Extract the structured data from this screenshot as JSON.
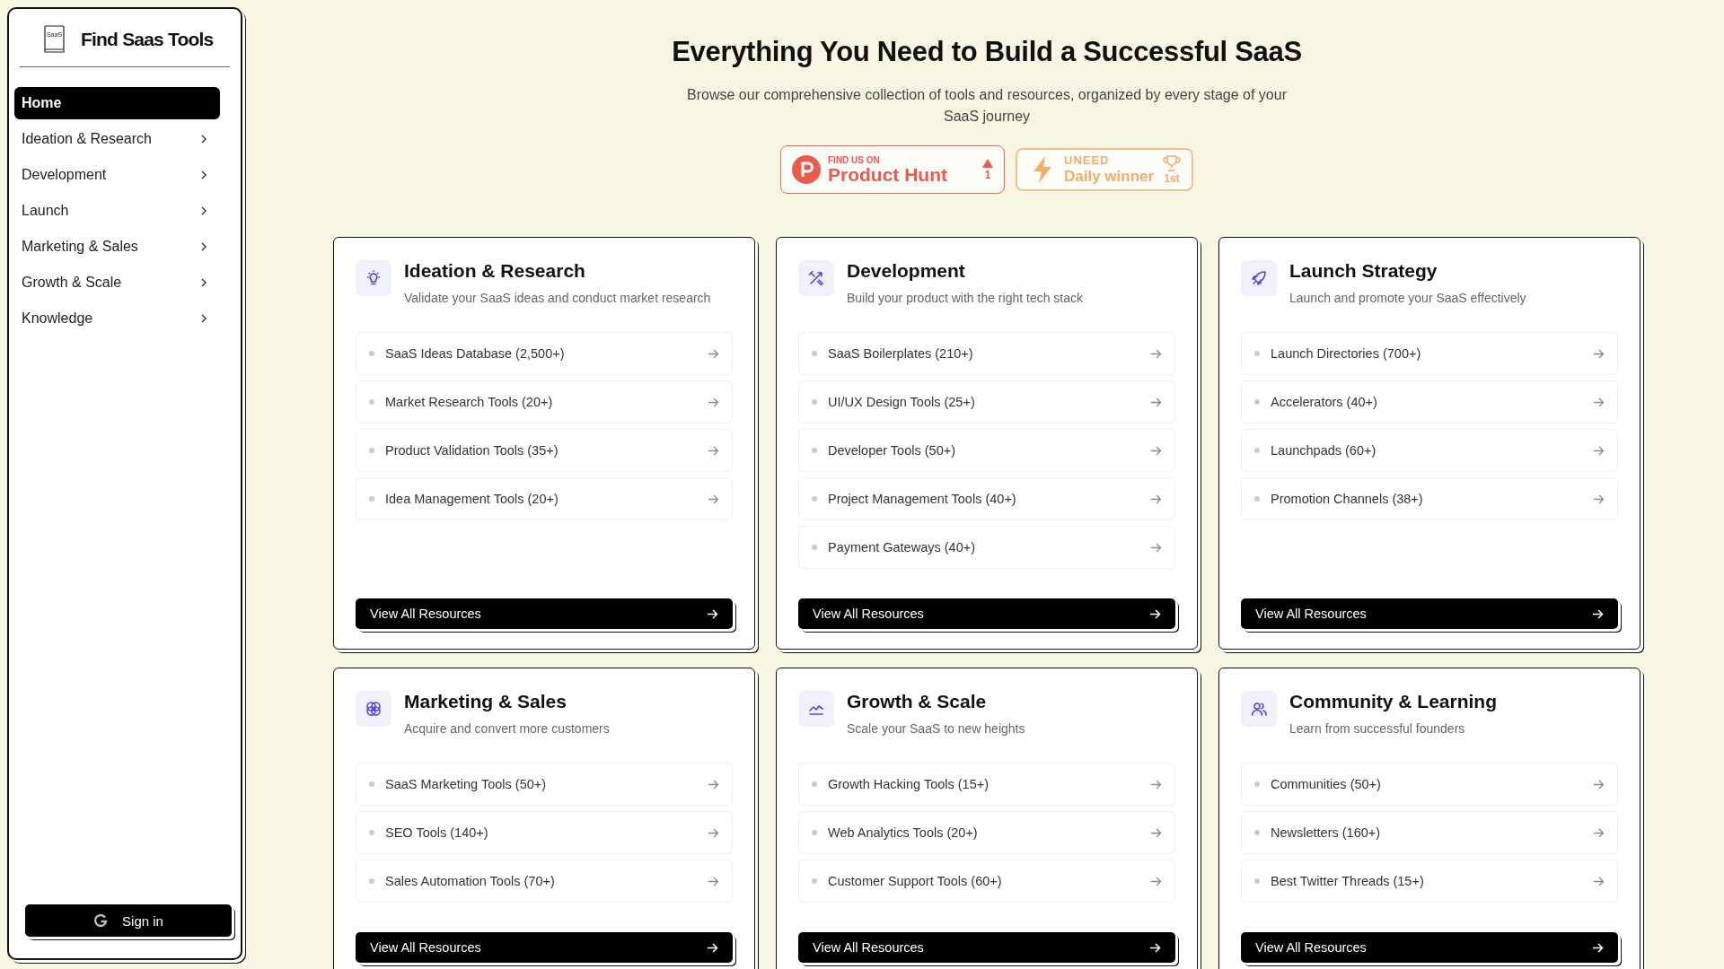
{
  "sidebar": {
    "logo_mark": "SaaS",
    "brand": "Find Saas Tools",
    "items": [
      {
        "label": "Home",
        "selected": true,
        "expandable": false
      },
      {
        "label": "Ideation & Research",
        "selected": false,
        "expandable": true
      },
      {
        "label": "Development",
        "selected": false,
        "expandable": true
      },
      {
        "label": "Launch",
        "selected": false,
        "expandable": true
      },
      {
        "label": "Marketing & Sales",
        "selected": false,
        "expandable": true
      },
      {
        "label": "Growth & Scale",
        "selected": false,
        "expandable": true
      },
      {
        "label": "Knowledge",
        "selected": false,
        "expandable": true
      }
    ],
    "sign_in": "Sign in"
  },
  "hero": {
    "title": "Everything You Need to Build a Successful SaaS",
    "subtitle": "Browse our comprehensive collection of tools and resources, organized by every stage of your SaaS journey",
    "badges": [
      {
        "kind": "producthunt",
        "eyebrow": "FIND US ON",
        "name": "Product Hunt",
        "count": "1"
      },
      {
        "kind": "uneed",
        "eyebrow": "UNEED",
        "name": "Daily winner",
        "count": "1st"
      }
    ]
  },
  "cards": [
    {
      "title": "Ideation & Research",
      "subtitle": "Validate your SaaS ideas and conduct market research",
      "links": [
        "SaaS Ideas Database (2,500+)",
        "Market Research Tools (20+)",
        "Product Validation Tools (35+)",
        "Idea Management Tools (20+)"
      ],
      "button": "View All Resources"
    },
    {
      "title": "Development",
      "subtitle": "Build your product with the right tech stack",
      "links": [
        "SaaS Boilerplates (210+)",
        "UI/UX Design Tools (25+)",
        "Developer Tools (50+)",
        "Project Management Tools (40+)",
        "Payment Gateways (40+)"
      ],
      "button": "View All Resources"
    },
    {
      "title": "Launch Strategy",
      "subtitle": "Launch and promote your SaaS effectively",
      "links": [
        "Launch Directories (700+)",
        "Accelerators (40+)",
        "Launchpads (60+)",
        "Promotion Channels (38+)"
      ],
      "button": "View All Resources"
    },
    {
      "title": "Marketing & Sales",
      "subtitle": "Acquire and convert more customers",
      "links": [
        "SaaS Marketing Tools (50+)",
        "SEO Tools (140+)",
        "Sales Automation Tools (70+)"
      ],
      "button": "View All Resources"
    },
    {
      "title": "Growth & Scale",
      "subtitle": "Scale your SaaS to new heights",
      "links": [
        "Growth Hacking Tools (15+)",
        "Web Analytics Tools (20+)",
        "Customer Support Tools (60+)"
      ],
      "button": "View All Resources"
    },
    {
      "title": "Community & Learning",
      "subtitle": "Learn from successful founders",
      "links": [
        "Communities (50+)",
        "Newsletters (160+)",
        "Best Twitter Threads (15+)"
      ],
      "button": "View All Resources"
    }
  ]
}
